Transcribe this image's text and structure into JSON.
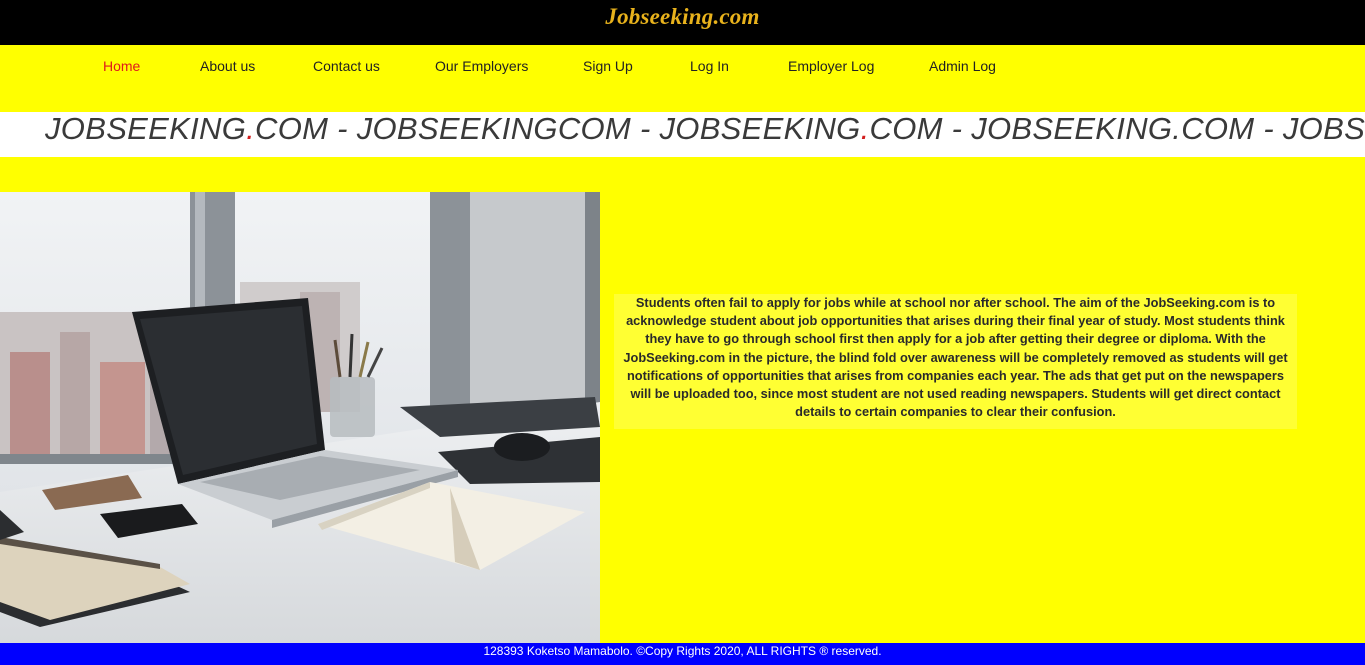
{
  "header": {
    "brand": "Jobseeking.com"
  },
  "nav": {
    "items": [
      {
        "label": "Home",
        "active": true
      },
      {
        "label": "About us"
      },
      {
        "label": "Contact us"
      },
      {
        "label": "Our Employers"
      },
      {
        "label": "Sign Up"
      },
      {
        "label": "Log In"
      },
      {
        "label": "Employer Log"
      },
      {
        "label": "Admin Log"
      }
    ],
    "active_color": "#e01b1b"
  },
  "marquee": {
    "p1": "JOBSEEKING",
    "dot1": ".",
    "p2": "COM - JOBSEEKINGCOM - JOBSEEKING",
    "dot2": ".",
    "p3": "COM - JOBSEEKING.COM - JOBSEEKING.COM"
  },
  "about": {
    "text": "Students often fail to apply for jobs while at school nor after school. The aim of the JobSeeking.com is to acknowledge student about job opportunities that arises during their final year of study. Most students think they have to go through school first then apply for a job after getting their degree or diploma. With the JobSeeking.com in the picture, the blind fold over awareness will be completely removed as students will get notifications of opportunities that arises from companies each year. The ads that get put on the newspapers will be uploaded too, since most student are not used reading newspapers. Students will get direct contact details to certain companies to clear their confusion."
  },
  "footer": {
    "text": "128393 Koketso Mamabolo. ©Copy Rights 2020, ALL RIGHTS ® reserved."
  },
  "colors": {
    "page_bg": "#ffff00",
    "topbar": "#000000",
    "brand": "#e8b21c",
    "footer_bg": "#0000ff"
  }
}
